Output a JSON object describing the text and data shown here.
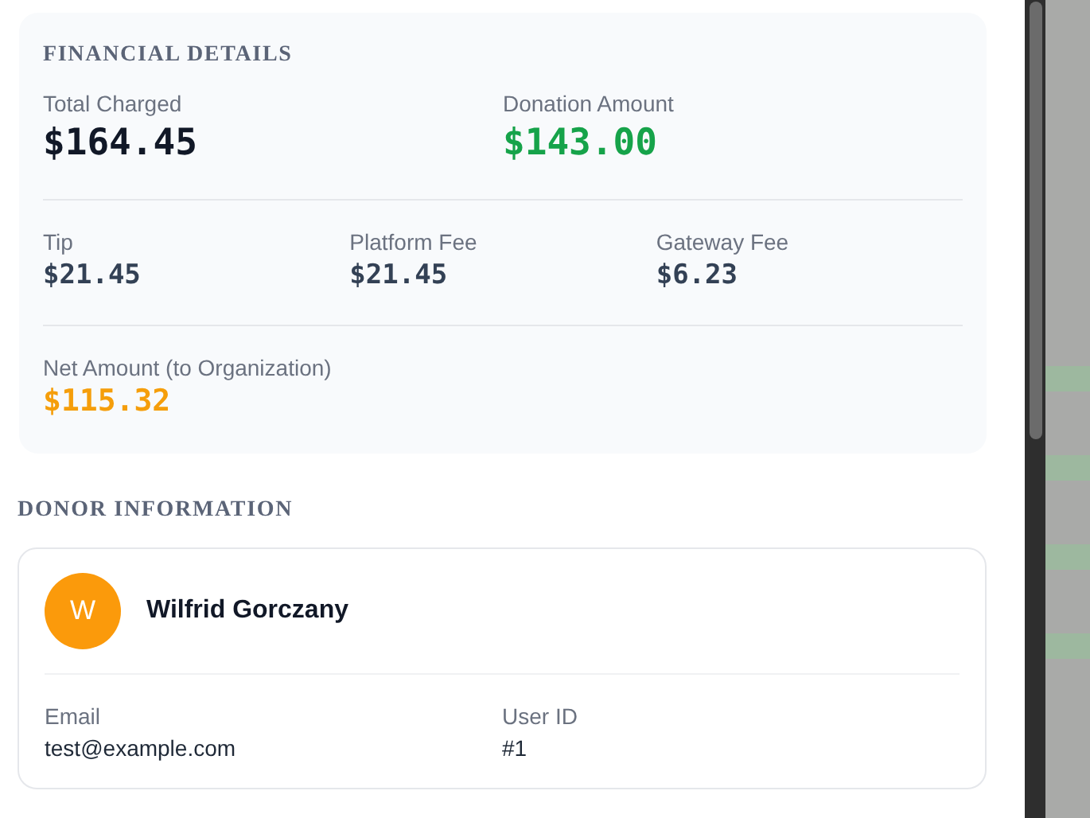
{
  "financial": {
    "heading": "FINANCIAL DETAILS",
    "rows": [
      {
        "kind": "headline",
        "items": [
          {
            "label": "Total Charged",
            "value": "$164.45",
            "color": "#111827"
          },
          {
            "label": "Donation Amount",
            "value": "$143.00",
            "color": "#16a34a"
          }
        ]
      },
      {
        "kind": "breakdown",
        "items": [
          {
            "label": "Tip",
            "value": "$21.45",
            "color": "#334155"
          },
          {
            "label": "Platform Fee",
            "value": "$21.45",
            "color": "#334155"
          },
          {
            "label": "Gateway Fee",
            "value": "$6.23",
            "color": "#334155"
          }
        ]
      },
      {
        "kind": "summary",
        "items": [
          {
            "label": "Net Amount (to Organization)",
            "value": "$115.32",
            "color": "#f59e0b"
          }
        ]
      }
    ]
  },
  "donor": {
    "heading": "DONOR INFORMATION",
    "initial": "W",
    "name": "Wilfrid Gorczany",
    "fields": [
      {
        "label": "Email",
        "value": "test@example.com"
      },
      {
        "label": "User ID",
        "value": "#1"
      }
    ]
  }
}
